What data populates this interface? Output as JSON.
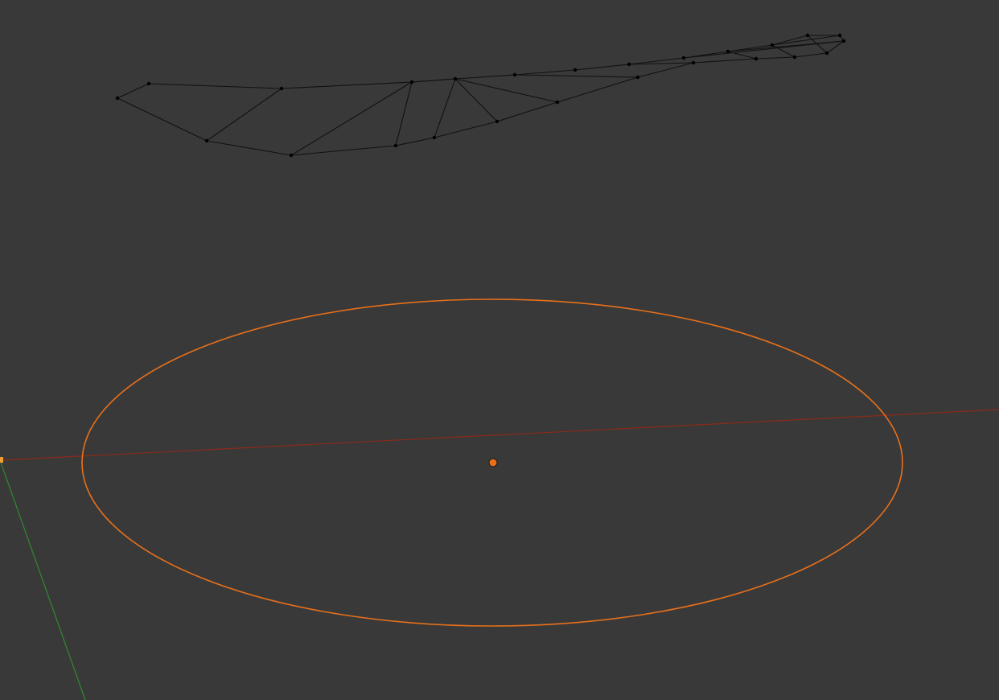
{
  "viewport": {
    "background_color": "#393939",
    "view_mode": "wireframe"
  },
  "colors": {
    "mesh_wire": "#111111",
    "mesh_vertex": "#000000",
    "selected_outline": "#e8701a",
    "object_origin": "#e8701a",
    "x_axis": "#8b2a1a",
    "y_axis": "#2e8b2e",
    "axis_marker": "#f0a030"
  },
  "objects": [
    {
      "name": "wireframe-mesh",
      "type": "mesh",
      "selected": false
    },
    {
      "name": "circle",
      "type": "curve",
      "selected": true
    }
  ]
}
